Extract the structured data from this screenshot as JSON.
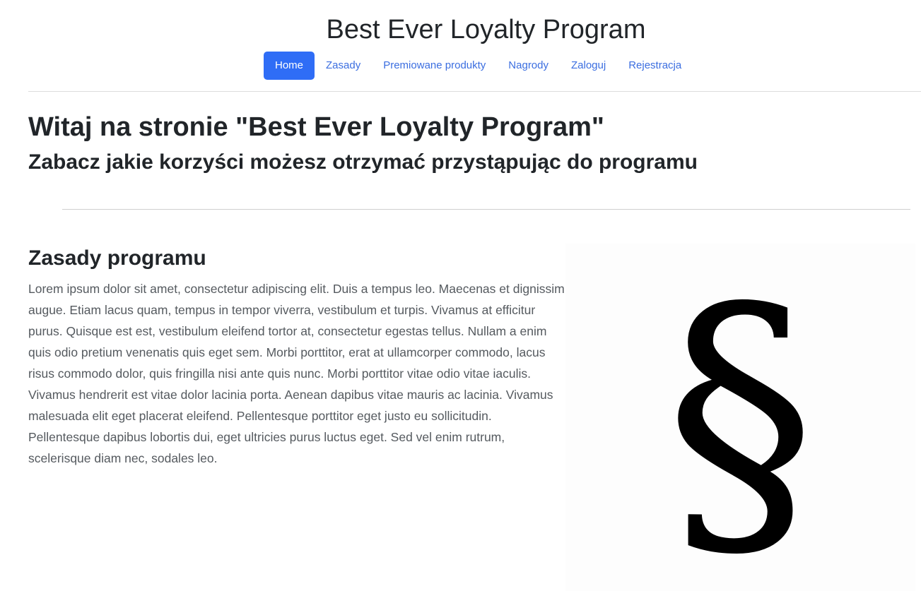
{
  "header": {
    "site_title": "Best Ever Loyalty Program"
  },
  "nav": {
    "items": [
      {
        "label": "Home",
        "active": true
      },
      {
        "label": "Zasady",
        "active": false
      },
      {
        "label": "Premiowane produkty",
        "active": false
      },
      {
        "label": "Nagrody",
        "active": false
      },
      {
        "label": "Zaloguj",
        "active": false
      },
      {
        "label": "Rejestracja",
        "active": false
      }
    ]
  },
  "hero": {
    "title": "Witaj na stronie \"Best Ever Loyalty Program\"",
    "subtitle": "Zabacz jakie korzyści możesz otrzymać przystąpując do programu"
  },
  "rules_section": {
    "title": "Zasady programu",
    "text": "Lorem ipsum dolor sit amet, consectetur adipiscing elit. Duis a tempus leo. Maecenas et dignissim augue. Etiam lacus quam, tempus in tempor viverra, vestibulum et turpis. Vivamus at efficitur purus. Quisque est est, vestibulum eleifend tortor at, consectetur egestas tellus. Nullam a enim quis odio pretium venenatis quis eget sem. Morbi porttitor, erat at ullamcorper commodo, lacus risus commodo dolor, quis fringilla nisi ante quis nunc. Morbi porttitor vitae odio vitae iaculis. Vivamus hendrerit est vitae dolor lacinia porta. Aenean dapibus vitae mauris ac lacinia. Vivamus malesuada elit eget placerat eleifend. Pellentesque porttitor eget justo eu sollicitudin. Pellentesque dapibus lobortis dui, eget ultricies purus luctus eget. Sed vel enim rutrum, scelerisque diam nec, sodales leo.",
    "image_glyph": "§",
    "image_icon": "section-sign-icon"
  },
  "colors": {
    "accent": "#2f6df6",
    "link": "#3b6ee0",
    "heading": "#212529",
    "body_text": "#555a5f"
  }
}
